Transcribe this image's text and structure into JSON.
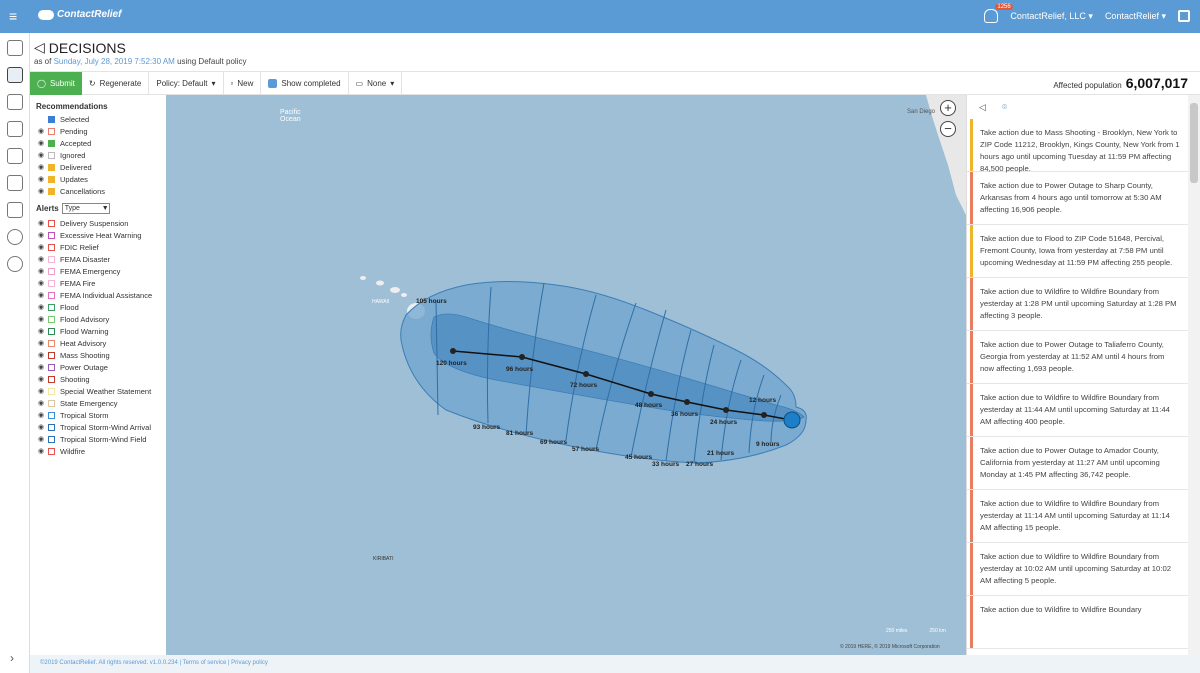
{
  "app": {
    "brand": "ContactRelief",
    "notifications_count": "1256",
    "org_menu": "ContactRelief, LLC",
    "user_menu": "ContactRelief"
  },
  "page": {
    "title": "DECISIONS",
    "subtitle_prefix": "as of ",
    "subtitle_date": "Sunday, July 28, 2019 7:52:30 AM",
    "subtitle_suffix": " using Default policy"
  },
  "toolbar": {
    "submit": "Submit",
    "regenerate": "Regenerate",
    "policy": "Policy: Default",
    "new": "New",
    "show_completed": "Show completed",
    "none": "None",
    "affected_label": "Affected population",
    "affected_value": "6,007,017"
  },
  "legend": {
    "recommendations_title": "Recommendations",
    "recommendations": [
      {
        "label": "Selected",
        "color": "#3a7fd5",
        "fill": true,
        "eye": false
      },
      {
        "label": "Pending",
        "color": "#e87e6e",
        "fill": false,
        "eye": true
      },
      {
        "label": "Accepted",
        "color": "#4caf50",
        "fill": true,
        "eye": true
      },
      {
        "label": "Ignored",
        "color": "#bbbbbb",
        "fill": false,
        "eye": true
      },
      {
        "label": "Delivered",
        "color": "#f0b429",
        "fill": true,
        "eye": true
      },
      {
        "label": "Updates",
        "color": "#f0b429",
        "fill": true,
        "eye": true
      },
      {
        "label": "Cancellations",
        "color": "#f0b429",
        "fill": true,
        "eye": true
      }
    ],
    "alerts_title": "Alerts",
    "alerts_filter": "Type",
    "alerts": [
      {
        "label": "Delivery Suspension",
        "color": "#e6524a"
      },
      {
        "label": "Excessive Heat Warning",
        "color": "#c24fb8"
      },
      {
        "label": "FDIC Relief",
        "color": "#e6524a"
      },
      {
        "label": "FEMA Disaster",
        "color": "#f5b6d6"
      },
      {
        "label": "FEMA Emergency",
        "color": "#f0a0c8"
      },
      {
        "label": "FEMA Fire",
        "color": "#f5b6d6"
      },
      {
        "label": "FEMA Individual Assistance",
        "color": "#e070c0"
      },
      {
        "label": "Flood",
        "color": "#3aa063"
      },
      {
        "label": "Flood Advisory",
        "color": "#7bc96f"
      },
      {
        "label": "Flood Warning",
        "color": "#2e8b57"
      },
      {
        "label": "Heat Advisory",
        "color": "#e88a6a"
      },
      {
        "label": "Mass Shooting",
        "color": "#c0392b"
      },
      {
        "label": "Power Outage",
        "color": "#9b59b6"
      },
      {
        "label": "Shooting",
        "color": "#c0392b"
      },
      {
        "label": "Special Weather Statement",
        "color": "#f4e6a0"
      },
      {
        "label": "State Emergency",
        "color": "#d8c8a8"
      },
      {
        "label": "Tropical Storm",
        "color": "#3a8fd5"
      },
      {
        "label": "Tropical Storm-Wind Arrival",
        "color": "#2c6fb5"
      },
      {
        "label": "Tropical Storm-Wind Field",
        "color": "#2c6fb5"
      },
      {
        "label": "Wildfire",
        "color": "#e6524a"
      }
    ]
  },
  "map": {
    "labels": {
      "pacific": "Pacific",
      "ocean": "Ocean",
      "hawaii": "HAWAII",
      "san_diego": "San Diego",
      "kiribati": "KIRIBATI"
    },
    "track_labels": [
      "105 hours",
      "120 hours",
      "96 hours",
      "72 hours",
      "48 hours",
      "36 hours",
      "24 hours",
      "12 hours",
      "9 hours",
      "21 hours",
      "27 hours",
      "33 hours",
      "45 hours",
      "57 hours",
      "69 hours",
      "81 hours",
      "93 hours"
    ],
    "scale_miles": "250 miles",
    "scale_km": "250 km",
    "copyright": "© 2019 HERE, © 2019 Microsoft Corporation"
  },
  "feed": {
    "items": [
      {
        "text": "Take action due to Mass Shooting - Brooklyn, New York to ZIP Code 11212, Brooklyn, Kings County, New York from 1 hours ago until upcoming Tuesday at 11:59 PM affecting 84,500 people.",
        "color": "#f0b429"
      },
      {
        "text": "Take action due to Power Outage to Sharp County, Arkansas from 4 hours ago until tomorrow at 5:30 AM affecting 16,906 people.",
        "color": "#e87e5e"
      },
      {
        "text": "Take action due to Flood to ZIP Code 51648, Percival, Fremont County, Iowa from yesterday at 7:58 PM until upcoming Wednesday at 11:59 PM affecting 255 people.",
        "color": "#f0b429"
      },
      {
        "text": "Take action due to Wildfire to Wildfire Boundary from yesterday at 1:28 PM until upcoming Saturday at 1:28 PM affecting 3 people.",
        "color": "#e87e5e"
      },
      {
        "text": "Take action due to Power Outage to Taliaferro County, Georgia from yesterday at 11:52 AM until 4 hours from now affecting 1,693 people.",
        "color": "#e87e5e"
      },
      {
        "text": "Take action due to Wildfire to Wildfire Boundary from yesterday at 11:44 AM until upcoming Saturday at 11:44 AM affecting 400 people.",
        "color": "#e87e5e"
      },
      {
        "text": "Take action due to Power Outage to Amador County, California from yesterday at 11:27 AM until upcoming Monday at 1:45 PM affecting 36,742 people.",
        "color": "#e87e5e"
      },
      {
        "text": "Take action due to Wildfire to Wildfire Boundary from yesterday at 11:14 AM until upcoming Saturday at 11:14 AM affecting 15 people.",
        "color": "#e87e5e"
      },
      {
        "text": "Take action due to Wildfire to Wildfire Boundary from yesterday at 10:02 AM until upcoming Saturday at 10:02 AM affecting 5 people.",
        "color": "#e87e5e"
      },
      {
        "text": "Take action due to Wildfire to Wildfire Boundary",
        "color": "#e87e5e"
      }
    ]
  },
  "footer": {
    "text": "©2019 ContactRelief. All rights reserved. v1.0.0.234 | Terms of service | Privacy policy"
  }
}
